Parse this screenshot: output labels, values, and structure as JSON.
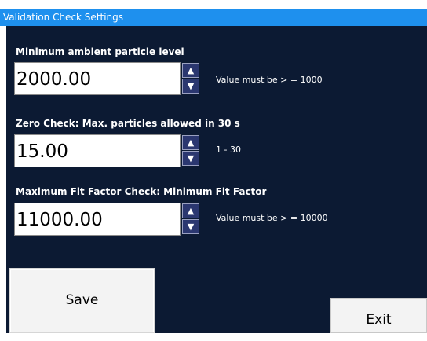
{
  "window": {
    "title": "Validation Check Settings"
  },
  "fields": [
    {
      "label": "Minimum ambient particle level",
      "value": "2000.00",
      "hint": "Value must be > = 1000"
    },
    {
      "label": "Zero Check: Max. particles allowed in 30 s",
      "value": "15.00",
      "hint": "1 - 30"
    },
    {
      "label": "Maximum Fit Factor Check: Minimum Fit Factor",
      "value": "11000.00",
      "hint": "Value must be > = 10000"
    }
  ],
  "icons": {
    "up": "up-arrow-icon",
    "down": "down-arrow-icon"
  },
  "buttons": {
    "save": "Save",
    "exit": "Exit"
  },
  "colors": {
    "title_bar": "#1e90ee",
    "panel_background": "#0c1a33",
    "spin_button": "#2b3770"
  }
}
